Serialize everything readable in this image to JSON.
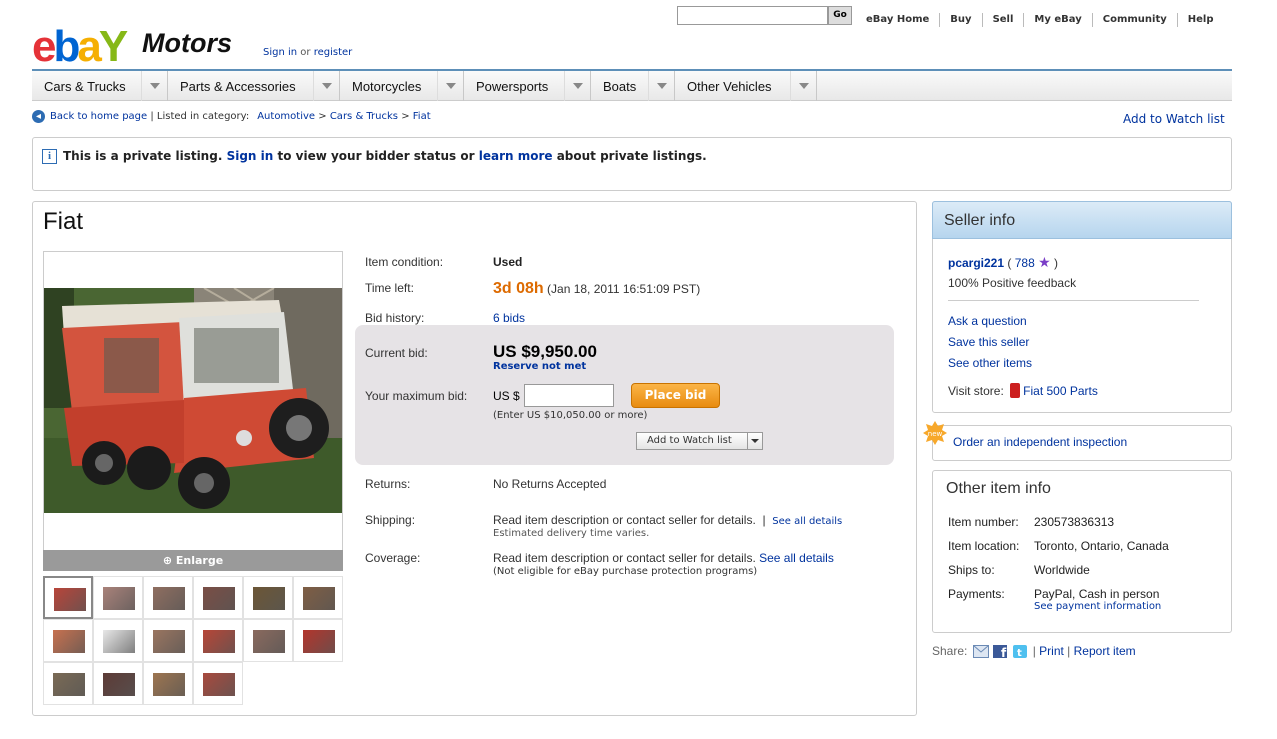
{
  "header": {
    "logo_letters": [
      {
        "ch": "e",
        "color": "#e53238"
      },
      {
        "ch": "b",
        "color": "#0064d2"
      },
      {
        "ch": "a",
        "color": "#f5af02"
      },
      {
        "ch": "Y",
        "color": "#86b817"
      }
    ],
    "logo_suffix": "Motors",
    "signin_text": "Sign in",
    "signin_or": " or ",
    "register_text": "register",
    "go_label": "Go",
    "top_nav": [
      "eBay Home",
      "Buy",
      "Sell",
      "My eBay",
      "Community",
      "Help"
    ]
  },
  "categories": [
    "Cars & Trucks",
    "Parts & Accessories",
    "Motorcycles",
    "Powersports",
    "Boats",
    "Other Vehicles"
  ],
  "breadcrumb": {
    "back": "Back to home page",
    "sep": " | ",
    "listed": "Listed in category:",
    "path": [
      "Automotive",
      "Cars & Trucks",
      "Fiat"
    ],
    "path_sep": " > ",
    "watch": "Add to Watch list"
  },
  "notice": {
    "icon": "info-icon",
    "part1": "This is a private listing. ",
    "signin": "Sign in",
    "part2": " to view your bidder status or ",
    "learn": "learn more",
    "part3": " about private listings."
  },
  "item": {
    "title": "Fiat",
    "enlarge": "Enlarge",
    "condition_label": "Item condition:",
    "condition": "Used",
    "time_label": "Time left:",
    "time_left": "3d 08h",
    "time_end": " (Jan 18, 2011 16:51:09 PST)",
    "history_label": "Bid history:",
    "bids": "6 bids",
    "current_bid_label": "Current bid:",
    "current_bid": "US $9,950.00",
    "reserve": "Reserve not met",
    "max_bid_label": "Your maximum bid:",
    "currency": "US $",
    "bid_value": "",
    "place_bid": "Place bid",
    "bid_hint": "(Enter US $10,050.00 or more)",
    "watch_button": "Add to Watch list",
    "returns_label": "Returns:",
    "returns": "No Returns Accepted",
    "shipping_label": "Shipping:",
    "shipping": "Read item description or contact seller for details.",
    "shipping_sep": "  |  ",
    "see_all_1": "See all details",
    "shipping_note": "Estimated delivery time varies.",
    "coverage_label": "Coverage:",
    "coverage": "Read item description or contact seller for details. ",
    "see_all_2": "See all details",
    "coverage_note": "(Not eligible for eBay purchase protection programs)"
  },
  "thumbnails": [
    {
      "c": "#b8453a"
    },
    {
      "c": "#a9827a"
    },
    {
      "c": "#8f6e60"
    },
    {
      "c": "#7a4e45"
    },
    {
      "c": "#6c5636"
    },
    {
      "c": "#7f5e44"
    },
    {
      "c": "#c7714f"
    },
    {
      "c": "#e8e8e8"
    },
    {
      "c": "#9a7560"
    },
    {
      "c": "#b74637"
    },
    {
      "c": "#8a6a5e"
    },
    {
      "c": "#b3352c"
    },
    {
      "c": "#7a6a55"
    },
    {
      "c": "#5d3b36"
    },
    {
      "c": "#9d7550"
    },
    {
      "c": "#a84a3e"
    }
  ],
  "seller": {
    "heading": "Seller info",
    "name": "pcargi221",
    "score_open": " ( ",
    "score": "788",
    "score_close": " )",
    "feedback": "100% Positive feedback",
    "ask": "Ask a question",
    "save": "Save this seller",
    "other": "See other items",
    "visit": "Visit store:",
    "store": "Fiat 500 Parts"
  },
  "inspection": {
    "badge": "new",
    "link": "Order an independent inspection"
  },
  "other_info": {
    "heading": "Other item info",
    "rows": [
      {
        "label": "Item number:",
        "value": "230573836313"
      },
      {
        "label": "Item location:",
        "value": "Toronto, Ontario, Canada"
      },
      {
        "label": "Ships to:",
        "value": "Worldwide"
      },
      {
        "label": "Payments:",
        "value": "PayPal, Cash in person"
      }
    ],
    "payment_link": "See payment information"
  },
  "share": {
    "label": "Share:",
    "print": "Print",
    "report": "Report item",
    "sep": " | "
  }
}
